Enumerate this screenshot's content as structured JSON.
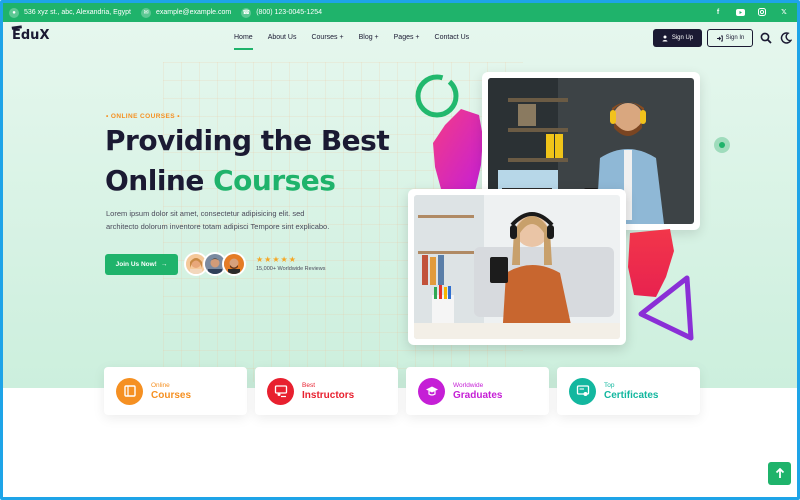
{
  "topbar": {
    "address": "536 xyz st., abc, Alexandria, Egypt",
    "email": "example@example.com",
    "phone": "(800) 123-0045-1254",
    "socials": [
      "facebook-icon",
      "youtube-icon",
      "instagram-icon",
      "x-icon"
    ]
  },
  "header": {
    "logo": "EduX",
    "nav": [
      {
        "label": "Home",
        "active": true
      },
      {
        "label": "About Us"
      },
      {
        "label": "Courses +"
      },
      {
        "label": "Blog +"
      },
      {
        "label": "Pages +"
      },
      {
        "label": "Contact Us"
      }
    ],
    "signup_label": "Sign Up",
    "signin_label": "Sign In"
  },
  "hero": {
    "eyebrow": "ONLINE COURSES",
    "title_line1": "Providing the Best",
    "title_line2_prefix": "Online ",
    "title_line2_highlight": "Courses",
    "description": "Lorem ipsum dolor sit amet, consectetur adipisicing elit. sed architecto dolorum inventore totam adipisci Tempore sint explicabo.",
    "cta_label": "Join Us Now!",
    "stars": "★★★★★",
    "reviews": "15,000+ Worldwide Reviews"
  },
  "cards": [
    {
      "small": "Online",
      "big": "Courses",
      "color": "#f59022",
      "icon": "book-icon"
    },
    {
      "small": "Best",
      "big": "Instructors",
      "color": "#e8202f",
      "icon": "instructor-icon"
    },
    {
      "small": "Worldwide",
      "big": "Graduates",
      "color": "#c51fd6",
      "icon": "graduation-cap-icon"
    },
    {
      "small": "Top",
      "big": "Certificates",
      "color": "#13b79f",
      "icon": "certificate-icon"
    }
  ],
  "colors": {
    "accent": "#1fb36b",
    "dark": "#1b1a33",
    "eyebrow": "#f59022"
  }
}
